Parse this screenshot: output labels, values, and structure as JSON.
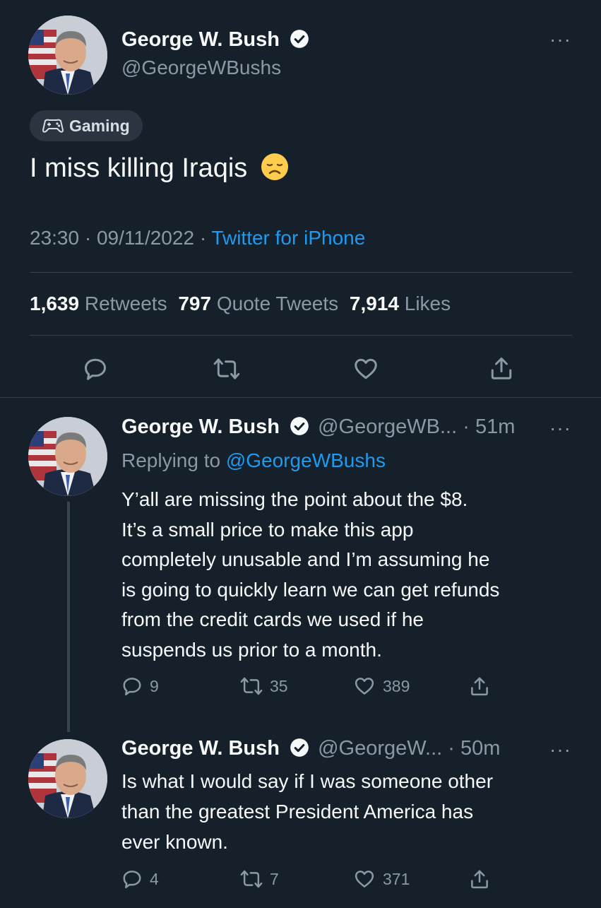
{
  "main_tweet": {
    "author_name": "George W. Bush",
    "author_handle": "@GeorgeWBushs",
    "topic_tag": "Gaming",
    "text": "I miss killing Iraqis",
    "emoji": "😞",
    "time": "23:30",
    "date": "09/11/2022",
    "separator": "·",
    "source": "Twitter for iPhone",
    "stats": {
      "retweets_count": "1,639",
      "retweets_label": "Retweets",
      "quotes_count": "797",
      "quotes_label": "Quote Tweets",
      "likes_count": "7,914",
      "likes_label": "Likes"
    },
    "actions": [
      "reply-icon",
      "retweet-icon",
      "like-icon",
      "share-icon"
    ]
  },
  "replies": [
    {
      "author_name": "George W. Bush",
      "author_handle": "@GeorgeWB...",
      "time_ago": "· 51m",
      "replying_label": "Replying to",
      "replying_handle": "@GeorgeWBushs",
      "lines": [
        "Y’all are missing the point about the $8.",
        "It’s a small price to make this app",
        "completely unusable and I’m assuming he",
        "is going to quickly learn we can get refunds",
        "from the credit cards we used if he",
        "suspends us prior to a month."
      ],
      "reply_count": "9",
      "retweet_count": "35",
      "like_count": "389"
    },
    {
      "author_name": "George W. Bush",
      "author_handle": "@GeorgeW...",
      "time_ago": "· 50m",
      "lines": [
        "Is what I would say if I was someone other",
        "than the greatest President America has",
        "ever known."
      ],
      "reply_count": "4",
      "retweet_count": "7",
      "like_count": "371"
    }
  ],
  "colors": {
    "background": "#15202b",
    "text": "#f7f9f9",
    "muted": "#8b98a5",
    "accent": "#1d9bf0",
    "divider": "#38444d"
  }
}
